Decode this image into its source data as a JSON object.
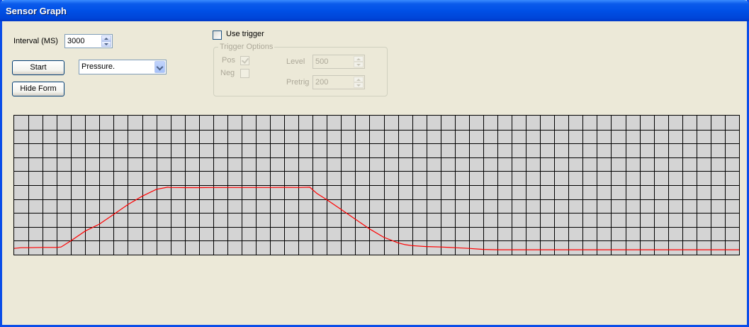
{
  "window": {
    "title": "Sensor Graph"
  },
  "controls": {
    "interval_label": "Interval (MS)",
    "interval_value": "3000",
    "start_label": "Start",
    "hide_form_label": "Hide Form",
    "sensor_selected": "Pressure."
  },
  "trigger": {
    "use_trigger_label": "Use trigger",
    "use_trigger_checked": false,
    "group_title": "Trigger Options",
    "pos_label": "Pos",
    "pos_checked": true,
    "neg_label": "Neg",
    "neg_checked": false,
    "level_label": "Level",
    "level_value": "500",
    "pretrig_label": "Pretrig",
    "pretrig_value": "200"
  },
  "chart_data": {
    "type": "line",
    "grid": true,
    "grid_columns": 51,
    "grid_rows": 10,
    "ylim": [
      0,
      10
    ],
    "xlim": [
      0,
      51
    ],
    "background": "#D4D4D4",
    "series": [
      {
        "color": "#FF0000",
        "x": [
          0,
          0.5,
          1,
          2,
          3,
          3.3,
          4,
          5,
          6,
          7,
          8,
          9,
          10,
          10.8,
          11,
          12,
          13,
          14,
          15,
          16,
          17,
          18,
          19,
          20,
          20.8,
          21.3,
          22,
          23,
          24,
          25,
          26,
          27,
          27.5,
          28,
          29,
          30,
          31,
          32,
          33,
          34,
          35,
          40,
          45,
          51
        ],
        "y": [
          0.45,
          0.5,
          0.5,
          0.52,
          0.52,
          0.55,
          1.0,
          1.7,
          2.2,
          2.9,
          3.6,
          4.2,
          4.7,
          4.85,
          4.83,
          4.82,
          4.82,
          4.83,
          4.83,
          4.83,
          4.83,
          4.83,
          4.84,
          4.83,
          4.85,
          4.4,
          3.95,
          3.25,
          2.55,
          1.85,
          1.25,
          0.85,
          0.72,
          0.65,
          0.58,
          0.55,
          0.5,
          0.45,
          0.38,
          0.35,
          0.35,
          0.35,
          0.35,
          0.35
        ]
      }
    ]
  }
}
